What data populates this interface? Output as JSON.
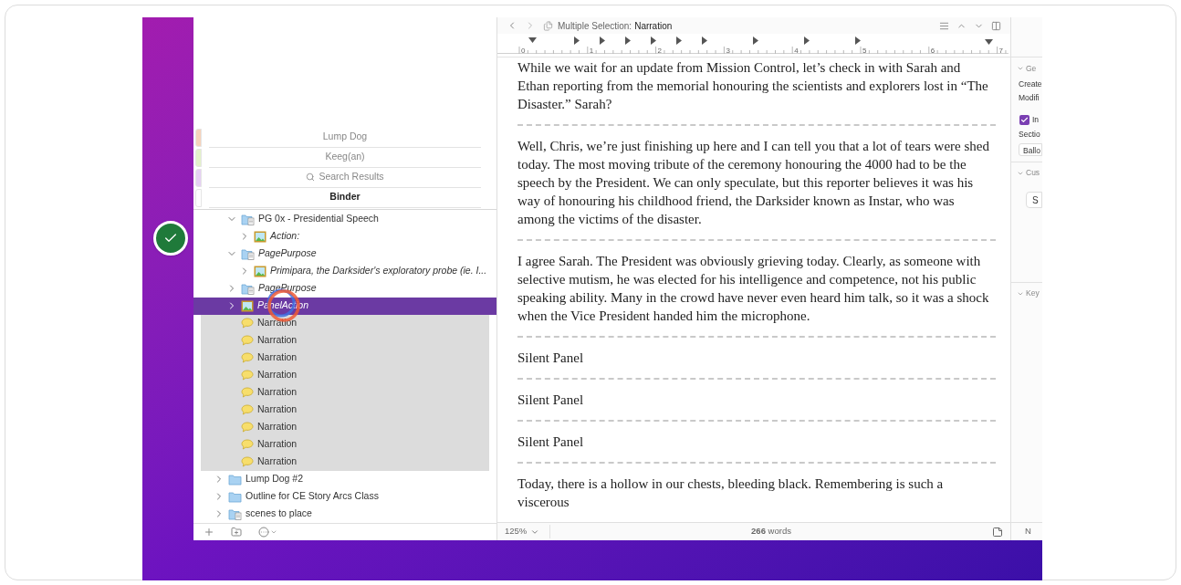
{
  "binder": {
    "collections": [
      {
        "label": "Lump Dog",
        "color": "#f6d3bb",
        "kind": "plain",
        "selected": false
      },
      {
        "label": "Keeg(an)",
        "color": "#e4f2ca",
        "kind": "plain",
        "selected": false
      },
      {
        "label": "Search Results",
        "color": "#e6d0f4",
        "kind": "search",
        "selected": false
      },
      {
        "label": "Binder",
        "color": "#ffffff",
        "kind": "plain",
        "selected": true
      }
    ],
    "tree": {
      "continued": [
        {
          "label": "PG 0x - Presidential Speech",
          "kind": "folder-doc",
          "italic": false,
          "expanded": true,
          "selected": false,
          "focused": false,
          "children": [
            {
              "label": "Action:",
              "kind": "image",
              "italic": true,
              "expanded": false,
              "selected": false,
              "focused": false
            }
          ]
        },
        {
          "label": "PagePurpose",
          "kind": "folder-doc",
          "italic": true,
          "expanded": true,
          "selected": false,
          "focused": false,
          "children": [
            {
              "label": "Primipara, the Darksider's exploratory probe (ie. I...",
              "kind": "image",
              "italic": true,
              "expanded": false,
              "selected": false,
              "focused": false
            }
          ]
        },
        {
          "label": "PagePurpose",
          "kind": "folder-doc",
          "italic": true,
          "expanded": false,
          "selected": false,
          "focused": false
        },
        {
          "label": "PanelAction",
          "kind": "image",
          "italic": true,
          "expanded": false,
          "selected": true,
          "focused": true
        },
        {
          "label": "Narration",
          "kind": "note",
          "italic": false,
          "selected": true,
          "focused": false
        },
        {
          "label": "Narration",
          "kind": "note",
          "italic": false,
          "selected": true,
          "focused": false
        },
        {
          "label": "Narration",
          "kind": "note",
          "italic": false,
          "selected": true,
          "focused": false
        },
        {
          "label": "Narration",
          "kind": "note",
          "italic": false,
          "selected": true,
          "focused": false
        },
        {
          "label": "Narration",
          "kind": "note",
          "italic": false,
          "selected": true,
          "focused": false
        },
        {
          "label": "Narration",
          "kind": "note",
          "italic": false,
          "selected": true,
          "focused": false
        },
        {
          "label": "Narration",
          "kind": "note",
          "italic": false,
          "selected": true,
          "focused": false
        },
        {
          "label": "Narration",
          "kind": "note",
          "italic": false,
          "selected": true,
          "focused": false
        },
        {
          "label": "Narration",
          "kind": "note",
          "italic": false,
          "selected": true,
          "focused": false
        }
      ],
      "items": [
        {
          "label": "Lump Dog #2",
          "kind": "folder",
          "italic": false,
          "expanded": false,
          "selected": false,
          "focused": false
        },
        {
          "label": "Outline for CE Story Arcs Class",
          "kind": "folder",
          "italic": false,
          "expanded": false,
          "selected": false,
          "focused": false
        },
        {
          "label": "scenes to place",
          "kind": "folder-doc",
          "italic": false,
          "expanded": false,
          "selected": false,
          "focused": false
        }
      ]
    }
  },
  "editor": {
    "header": {
      "prefix": "Multiple Selection:",
      "title": "Narration"
    },
    "ruler": [
      "0",
      "1",
      "2",
      "3",
      "4",
      "5",
      "6",
      "7"
    ],
    "paragraphs": [
      "While we wait for an update from Mission Control, let’s check in with Sarah and Ethan reporting from the memorial honouring the scientists and explorers lost in “The Disaster.” Sarah?",
      "Well, Chris, we’re just finishing up here and I can tell you that a lot of tears were shed today. The most moving tribute of the ceremony honouring the 4000 had to be the speech by the President. We can only speculate, but this reporter believes it was his way of honouring his childhood friend, the Darksider known as Instar, who was among the victims of the disaster.",
      "I agree Sarah. The President was obviously grieving today. Clearly, as someone with selective mutism, he was elected for his intelligence and competence, not his public speaking ability. Many in the crowd have never even heard him talk, so it was a shock when the Vice President handed him the microphone.",
      "Silent Panel",
      "Silent Panel",
      "Silent Panel",
      "Today, there is a hollow in our chests, bleeding black. Remembering is such a viscerous"
    ],
    "zoom": "125%",
    "word_count": {
      "number": "266",
      "label": "words"
    }
  },
  "inspector": {
    "sections": [
      {
        "title": "Ge",
        "kind": "general",
        "lines": [
          "Create",
          "Modifi"
        ],
        "checkbox": {
          "label": "In",
          "checked": true
        },
        "field_label": "Sectio",
        "field_value": "Ballo"
      },
      {
        "title": "Cus",
        "kind": "custom",
        "button": "S"
      },
      {
        "title": "Key",
        "kind": "keywords"
      }
    ],
    "footer": "N"
  }
}
